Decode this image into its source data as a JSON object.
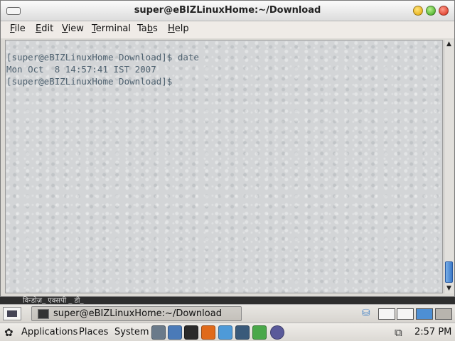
{
  "window": {
    "title": "super@eBIZLinuxHome:~/Download"
  },
  "menubar": {
    "file": {
      "pre": "",
      "key": "F",
      "post": "ile"
    },
    "edit": {
      "pre": "",
      "key": "E",
      "post": "dit"
    },
    "view": {
      "pre": "",
      "key": "V",
      "post": "iew"
    },
    "terminal": {
      "pre": "",
      "key": "T",
      "post": "erminal"
    },
    "tabs": {
      "pre": "Ta",
      "key": "b",
      "post": "s"
    },
    "help": {
      "pre": "",
      "key": "H",
      "post": "elp"
    }
  },
  "terminal": {
    "lines": [
      "[super@eBIZLinuxHome Download]$ date",
      "Mon Oct  8 14:57:41 IST 2007",
      "[super@eBIZLinuxHome Download]$"
    ],
    "text_color": "#4f6270"
  },
  "desktop": {
    "strip_text": "विन्डोज़_ एक्सपी _ डी_"
  },
  "taskbar": {
    "task_label": "super@eBIZLinuxHome:~/Download"
  },
  "panel": {
    "applications": "Applications",
    "places": "Places",
    "system": "System",
    "clock": "2:57 PM",
    "icons": [
      "gnome-foot-icon",
      "file-manager-icon",
      "network-icon"
    ]
  },
  "colors": {
    "workspace_active": "#4d8fd4",
    "scroll_thumb": "#3a78c8"
  }
}
